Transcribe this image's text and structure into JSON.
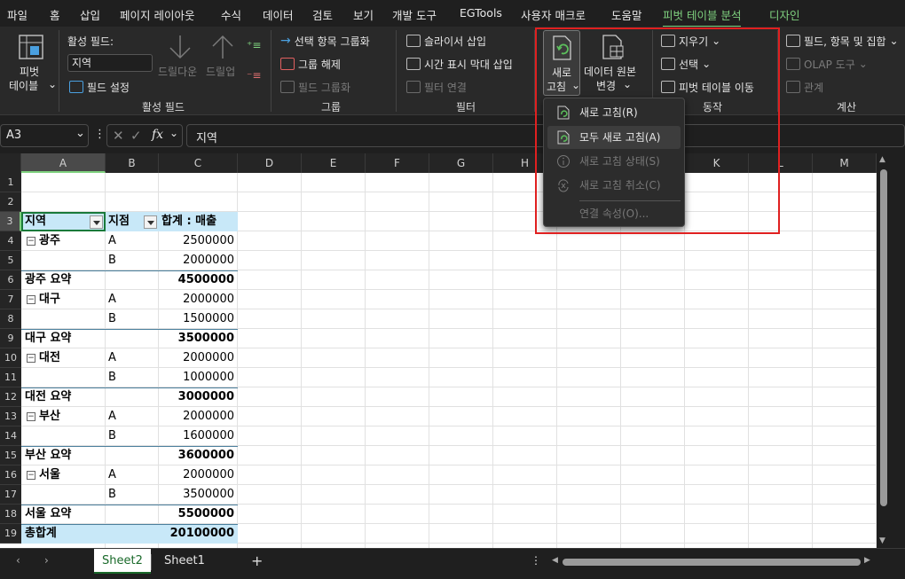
{
  "menu_tabs": [
    "파일",
    "홈",
    "삽입",
    "페이지 레이아웃",
    "수식",
    "데이터",
    "검토",
    "보기",
    "개발 도구",
    "EGTools",
    "사용자 매크로",
    "도움말",
    "피벗 테이블 분석",
    "디자인"
  ],
  "ribbon": {
    "pivot_table_label_1": "피벗",
    "pivot_table_label_2": "테이블",
    "active_field_title": "활성 필드:",
    "active_field_value": "지역",
    "drill_down": "드릴다운",
    "drill_up": "드릴업",
    "field_settings": "필드 설정",
    "group_active_field": "활성 필드",
    "group_selection": "선택 항목 그룹화",
    "ungroup": "그룹 해제",
    "group_field": "필드 그룹화",
    "group_group": "그룹",
    "insert_slicer": "슬라이서 삽입",
    "insert_timeline": "시간 표시 막대 삽입",
    "filter_connections": "필터 연결",
    "group_filter": "필터",
    "refresh_1": "새로",
    "refresh_2": "고침",
    "change_source_1": "데이터 원본",
    "change_source_2": "변경",
    "clear": "지우기",
    "select": "선택",
    "move_pivot": "피벗 테이블 이동",
    "group_actions": "동작",
    "fields_items_sets": "필드, 항목 및 집합",
    "olap_tools": "OLAP 도구",
    "relationships": "관계",
    "group_calc": "계산"
  },
  "formula_bar": {
    "name_box": "A3",
    "formula": "지역",
    "fx": "fx"
  },
  "columns": [
    "A",
    "B",
    "C",
    "D",
    "E",
    "F",
    "G",
    "H",
    "I",
    "J",
    "K",
    "L",
    "M"
  ],
  "rows": [
    "1",
    "2",
    "3",
    "4",
    "5",
    "6",
    "7",
    "8",
    "9",
    "10",
    "11",
    "12",
    "13",
    "14",
    "15",
    "16",
    "17",
    "18",
    "19"
  ],
  "pivot": {
    "header_region": "지역",
    "header_branch": "지점",
    "header_sum": "합계 : 매출",
    "rows": [
      {
        "region": "광주",
        "branch": "A",
        "value": "2500000"
      },
      {
        "region": "",
        "branch": "B",
        "value": "2000000"
      },
      {
        "subtotal": "광주 요약",
        "value": "4500000"
      },
      {
        "region": "대구",
        "branch": "A",
        "value": "2000000"
      },
      {
        "region": "",
        "branch": "B",
        "value": "1500000"
      },
      {
        "subtotal": "대구 요약",
        "value": "3500000"
      },
      {
        "region": "대전",
        "branch": "A",
        "value": "2000000"
      },
      {
        "region": "",
        "branch": "B",
        "value": "1000000"
      },
      {
        "subtotal": "대전 요약",
        "value": "3000000"
      },
      {
        "region": "부산",
        "branch": "A",
        "value": "2000000"
      },
      {
        "region": "",
        "branch": "B",
        "value": "1600000"
      },
      {
        "subtotal": "부산 요약",
        "value": "3600000"
      },
      {
        "region": "서울",
        "branch": "A",
        "value": "2000000"
      },
      {
        "region": "",
        "branch": "B",
        "value": "3500000"
      },
      {
        "subtotal": "서울 요약",
        "value": "5500000"
      }
    ],
    "grand_total_label": "총합계",
    "grand_total_value": "20100000"
  },
  "dropdown": {
    "refresh": "새로 고침(R)",
    "refresh_all": "모두 새로 고침(A)",
    "refresh_status": "새로 고침 상태(S)",
    "cancel_refresh": "새로 고침 취소(C)",
    "connection_props": "연결 속성(O)..."
  },
  "sheets": [
    "Sheet2",
    "Sheet1"
  ],
  "colors": {
    "accent": "#7fd17f",
    "highlight_box": "#e02020",
    "pivot_header": "#c8e8f8"
  }
}
